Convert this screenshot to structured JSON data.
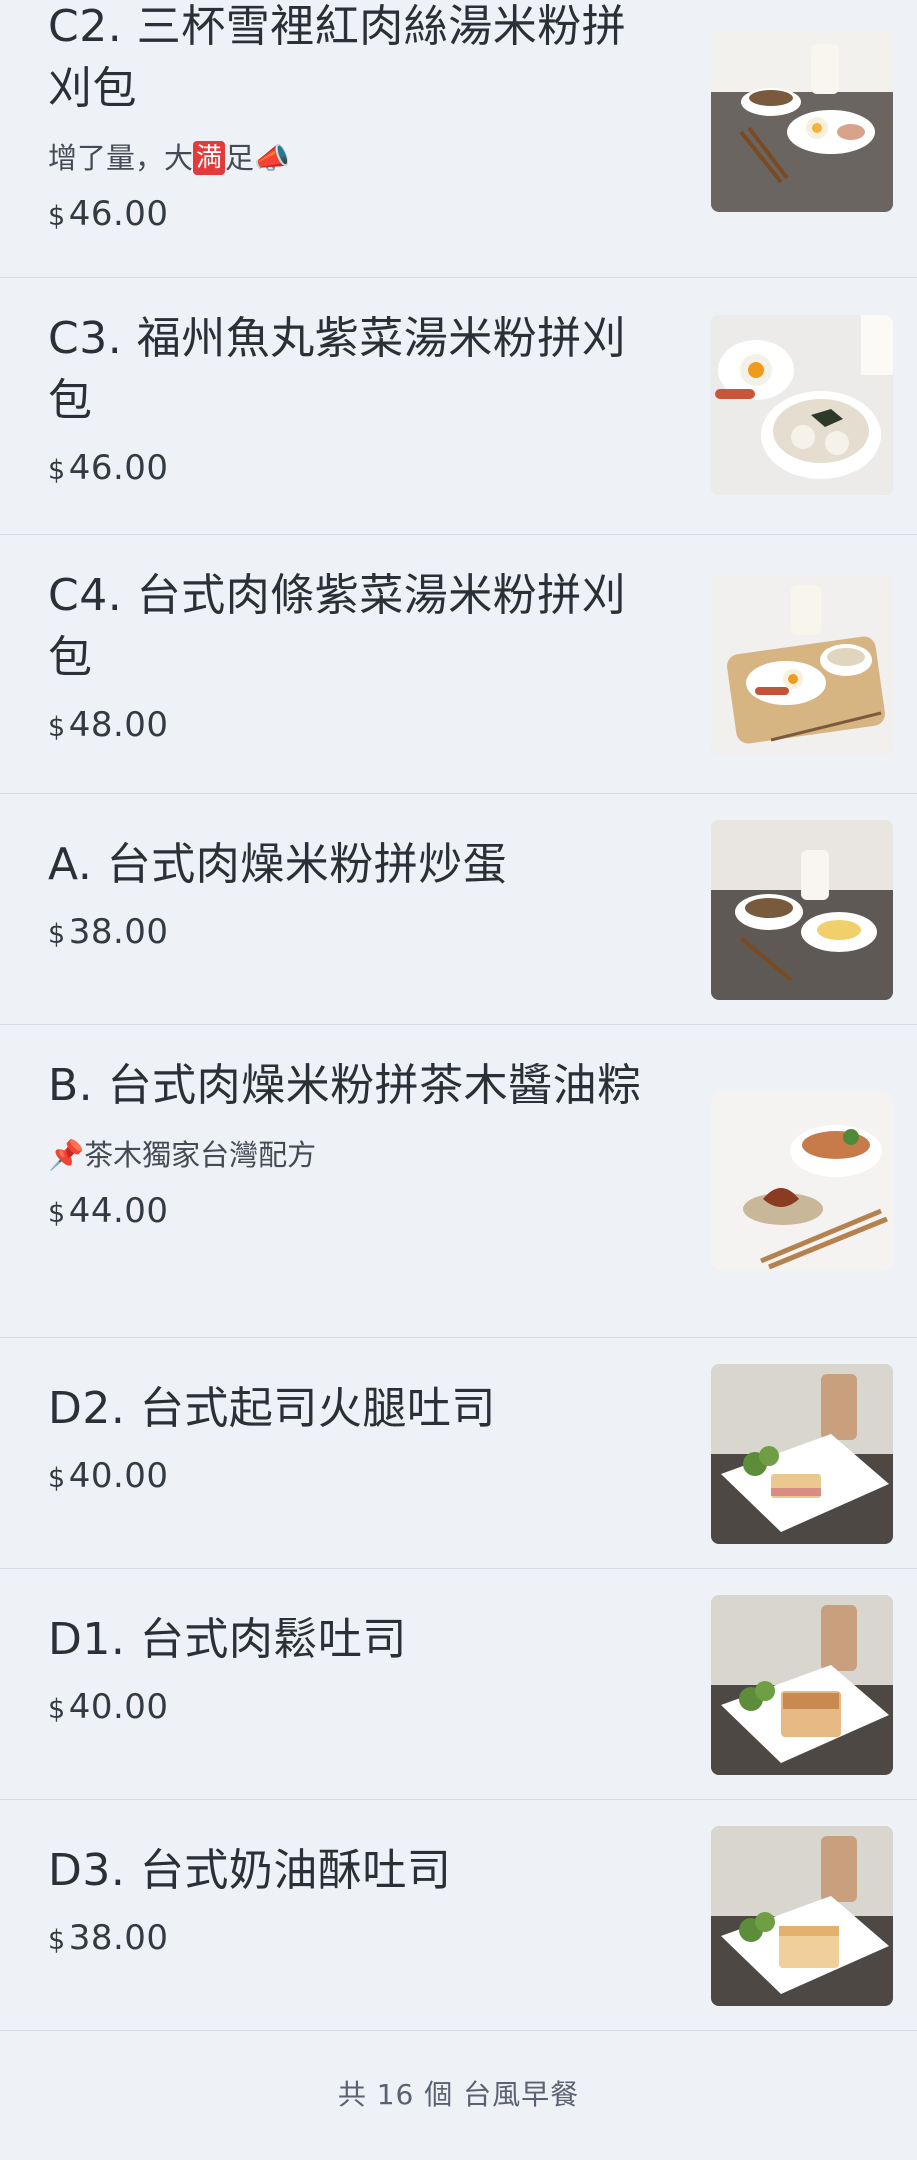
{
  "items": [
    {
      "title": "C2. 三杯雪裡紅肉絲湯米粉拼刈包",
      "desc_pre": "增了量，大",
      "desc_badge": "満",
      "desc_post": "足📣",
      "currency": "$",
      "price": "46.00",
      "image": "breakfast-set-photo"
    },
    {
      "title": "C3. 福州魚丸紫菜湯米粉拼刈包",
      "currency": "$",
      "price": "46.00",
      "image": "breakfast-set-photo"
    },
    {
      "title": "C4. 台式肉條紫菜湯米粉拼刈包",
      "currency": "$",
      "price": "48.00",
      "image": "breakfast-set-photo"
    },
    {
      "title": "A. 台式肉燥米粉拼炒蛋",
      "currency": "$",
      "price": "38.00",
      "image": "breakfast-set-photo"
    },
    {
      "title": "B. 台式肉燥米粉拼茶木醬油粽",
      "desc": "📌茶木獨家台灣配方",
      "currency": "$",
      "price": "44.00",
      "image": "rice-dumpling-set-photo"
    },
    {
      "title": "D2. 台式起司火腿吐司",
      "currency": "$",
      "price": "40.00",
      "image": "toast-set-photo"
    },
    {
      "title": "D1. 台式肉鬆吐司",
      "currency": "$",
      "price": "40.00",
      "image": "toast-set-photo"
    },
    {
      "title": "D3. 台式奶油酥吐司",
      "currency": "$",
      "price": "38.00",
      "image": "toast-set-photo"
    }
  ],
  "footer": {
    "summary": "共 16 個 台風早餐"
  },
  "colors": {
    "background": "#eef1f6",
    "divider": "#d9dde3",
    "text": "#2b2f36",
    "badge": "#e23b3b"
  }
}
